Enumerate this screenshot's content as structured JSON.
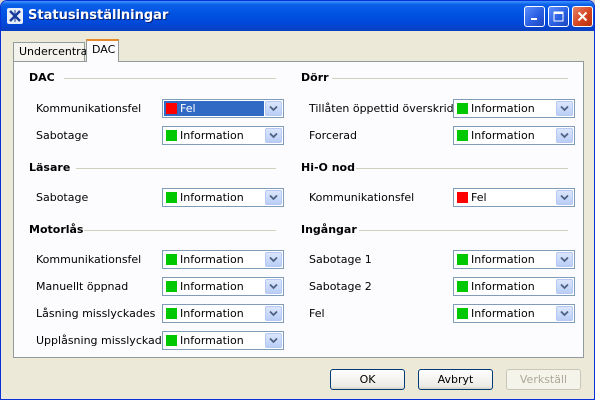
{
  "window": {
    "title": "Statusinställningar"
  },
  "tabs": [
    {
      "label": "Undercentral",
      "active": false
    },
    {
      "label": "DAC",
      "active": true
    }
  ],
  "colors": {
    "red": "#ff0000",
    "green": "#00c800",
    "selection": "#316ac5"
  },
  "left_groups": [
    {
      "title": "DAC",
      "rows": [
        {
          "label": "Kommunikationsfel",
          "value": "Fel",
          "color": "red",
          "selected": true
        },
        {
          "label": "Sabotage",
          "value": "Information",
          "color": "green"
        }
      ]
    },
    {
      "title": "Läsare",
      "rows": [
        {
          "label": "Sabotage",
          "value": "Information",
          "color": "green"
        }
      ]
    },
    {
      "title": "Motorlås",
      "rows": [
        {
          "label": "Kommunikationsfel",
          "value": "Information",
          "color": "green"
        },
        {
          "label": "Manuellt öppnad",
          "value": "Information",
          "color": "green"
        },
        {
          "label": "Låsning misslyckades",
          "value": "Information",
          "color": "green"
        },
        {
          "label": "Upplåsning misslyckades",
          "value": "Information",
          "color": "green"
        }
      ]
    }
  ],
  "right_groups": [
    {
      "title": "Dörr",
      "rows": [
        {
          "label": "Tillåten öppettid överskriden",
          "value": "Information",
          "color": "green"
        },
        {
          "label": "Forcerad",
          "value": "Information",
          "color": "green"
        }
      ]
    },
    {
      "title": "Hi-O nod",
      "rows": [
        {
          "label": "Kommunikationsfel",
          "value": "Fel",
          "color": "red"
        }
      ]
    },
    {
      "title": "Ingångar",
      "rows": [
        {
          "label": "Sabotage 1",
          "value": "Information",
          "color": "green"
        },
        {
          "label": "Sabotage 2",
          "value": "Information",
          "color": "green"
        },
        {
          "label": "Fel",
          "value": "Information",
          "color": "green"
        }
      ]
    }
  ],
  "buttons": {
    "ok": "OK",
    "cancel": "Avbryt",
    "apply": "Verkställ"
  }
}
